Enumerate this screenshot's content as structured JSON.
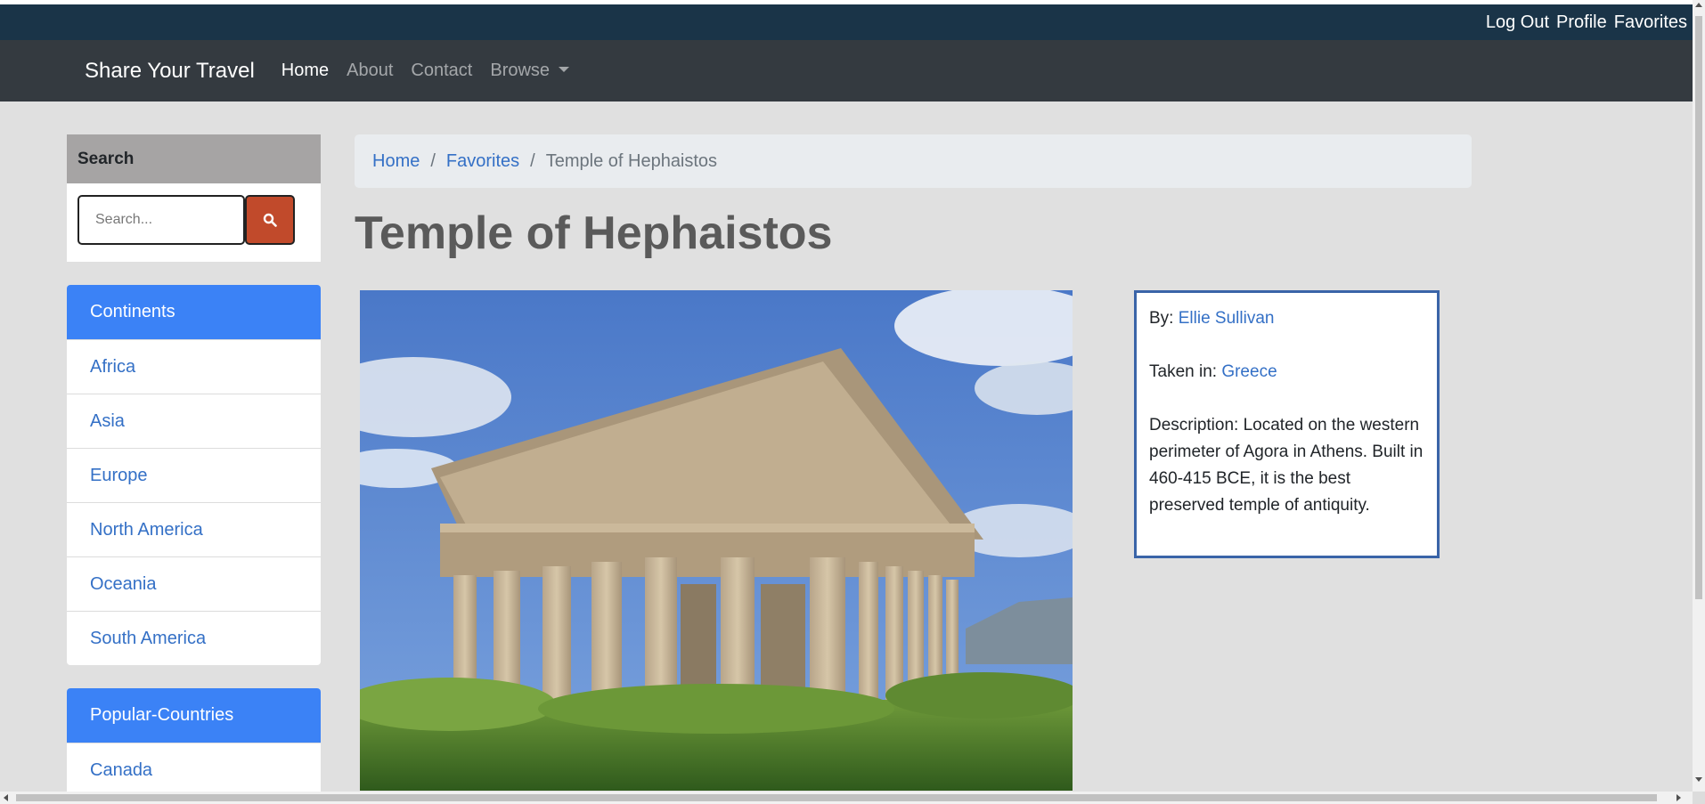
{
  "userbar": {
    "logout": "Log Out",
    "profile": "Profile",
    "favorites": "Favorites"
  },
  "navbar": {
    "brand": "Share Your Travel",
    "links": [
      "Home",
      "About",
      "Contact",
      "Browse"
    ]
  },
  "search": {
    "heading": "Search",
    "placeholder": "Search...",
    "icon": "search-icon"
  },
  "continents": {
    "heading": "Continents",
    "items": [
      "Africa",
      "Asia",
      "Europe",
      "North America",
      "Oceania",
      "South America"
    ]
  },
  "popular": {
    "heading": "Popular-Countries",
    "items": [
      "Canada"
    ]
  },
  "breadcrumb": {
    "home": "Home",
    "favorites": "Favorites",
    "current": "Temple of Hephaistos",
    "separator": "/"
  },
  "page_title": "Temple of Hephaistos",
  "info": {
    "by_label": "By: ",
    "by_value": "Ellie Sullivan",
    "taken_label": "Taken in: ",
    "taken_value": "Greece",
    "description": "Description: Located on the western perimeter of Agora in Athens. Built in 460-415 BCE, it is the best preserved temple of antiquity."
  },
  "colors": {
    "accent": "#3b82f6",
    "link": "#3470c6",
    "navbar": "#343a40",
    "userbar": "#1a3448",
    "search_button": "#c14a2b"
  }
}
